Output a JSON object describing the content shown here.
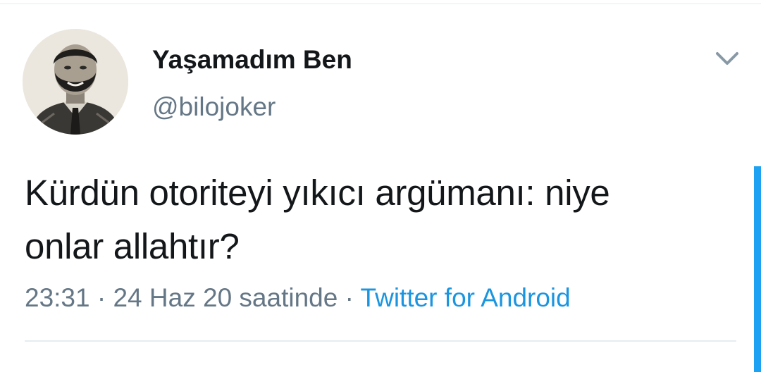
{
  "user": {
    "display_name": "Yaşamadım Ben",
    "handle": "@bilojoker",
    "avatar_icon": "user-avatar"
  },
  "tweet": {
    "text_line1": "Kürdün otoriteyi yıkıcı argümanı: niye",
    "text_line2": "onlar allahtır?",
    "time": "23:31",
    "separator": " · ",
    "date": "24 Haz 20 saatinde",
    "source": "Twitter for Android"
  },
  "icons": {
    "menu": "chevron-down-icon"
  },
  "colors": {
    "text": "#14171a",
    "secondary": "#657786",
    "link": "#1b95e0",
    "accent": "#1da1f2",
    "divider": "#e6ecf0"
  }
}
